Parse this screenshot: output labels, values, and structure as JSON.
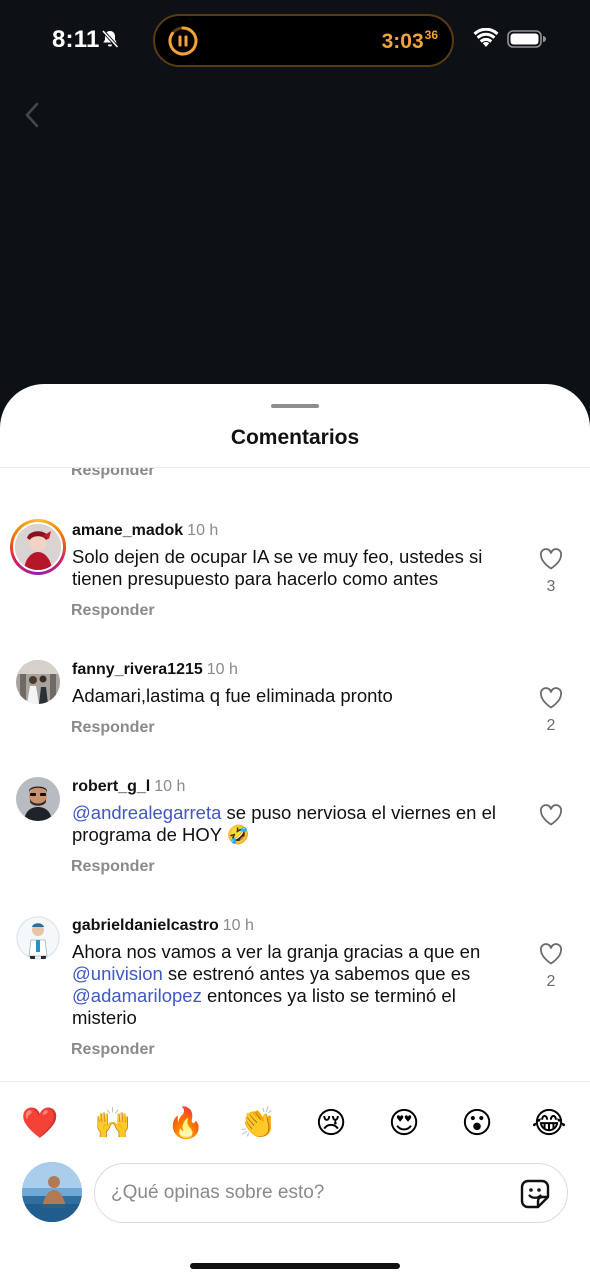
{
  "status_bar": {
    "time": "8:11",
    "timer_main": "3:03",
    "timer_fraction": "36"
  },
  "sheet": {
    "title": "Comentarios",
    "reply_label": "Responder"
  },
  "comments": [
    {
      "username": "amane_madok",
      "age": "10 h",
      "text": "Solo dejen de ocupar IA se ve muy feo, ustedes si tienen presupuesto para hacerlo como antes",
      "likes": "3"
    },
    {
      "username": "fanny_rivera1215",
      "age": "10 h",
      "text": "Adamari,lastima q fue eliminada pronto",
      "likes": "2"
    },
    {
      "username": "robert_g_l",
      "age": "10 h",
      "mention": "@andrealegarreta",
      "text": " se puso nerviosa el viernes en el programa de HOY 🤣",
      "likes": ""
    },
    {
      "username": "gabrieldanielcastro",
      "age": "10 h",
      "text_a": "Ahora nos vamos a ver la granja gracias a que en ",
      "mention_a": "@univision",
      "text_b": " se estrenó antes ya sabemos que es ",
      "mention_b": "@adamarilopez",
      "text_c": " entonces ya listo se terminó el misterio",
      "likes": "2"
    }
  ],
  "reactions": [
    "❤️",
    "🙌",
    "🔥",
    "👏",
    "😢",
    "😍",
    "😮",
    "😂"
  ],
  "composer": {
    "placeholder": "¿Qué opinas sobre esto?"
  },
  "colors": {
    "accent_timer": "#f2a33a",
    "mention": "#3f58c4",
    "background_dark": "#0d1015"
  }
}
